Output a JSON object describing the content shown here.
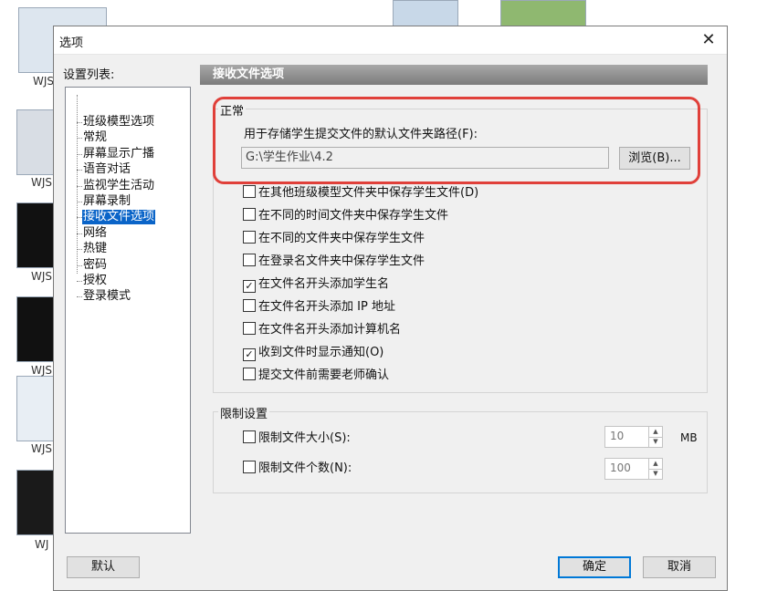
{
  "background": {
    "icon_labels": [
      "WJS",
      "WJS",
      "WJS",
      "WJS",
      "WJS",
      "WJ"
    ]
  },
  "dialog": {
    "title": "选项",
    "close_glyph": "✕",
    "settings_list_label": "设置列表:",
    "tree_items": [
      {
        "label": "班级模型选项",
        "selected": false
      },
      {
        "label": "常规",
        "selected": false
      },
      {
        "label": "屏幕显示广播",
        "selected": false
      },
      {
        "label": "语音对话",
        "selected": false
      },
      {
        "label": "监视学生活动",
        "selected": false
      },
      {
        "label": "屏幕录制",
        "selected": false
      },
      {
        "label": "接收文件选项",
        "selected": true
      },
      {
        "label": "网络",
        "selected": false
      },
      {
        "label": "热键",
        "selected": false
      },
      {
        "label": "密码",
        "selected": false
      },
      {
        "label": "授权",
        "selected": false
      },
      {
        "label": "登录模式",
        "selected": false
      }
    ],
    "panel_title": "接收文件选项",
    "normal_group": {
      "label": "正常",
      "path_label": "用于存储学生提交文件的默认文件夹路径(F):",
      "path_value": "G:\\学生作业\\4.2",
      "browse_label": "浏览(B)...",
      "options": [
        {
          "label": "在其他班级模型文件夹中保存学生文件(D)",
          "checked": false
        },
        {
          "label": "在不同的时间文件夹中保存学生文件",
          "checked": false
        },
        {
          "label": "在不同的文件夹中保存学生文件",
          "checked": false
        },
        {
          "label": "在登录名文件夹中保存学生文件",
          "checked": false
        },
        {
          "label": "在文件名开头添加学生名",
          "checked": true
        },
        {
          "label": "在文件名开头添加 IP 地址",
          "checked": false
        },
        {
          "label": "在文件名开头添加计算机名",
          "checked": false
        },
        {
          "label": "收到文件时显示通知(O)",
          "checked": true
        },
        {
          "label": "提交文件前需要老师确认",
          "checked": false
        }
      ]
    },
    "limit_group": {
      "label": "限制设置",
      "size_label": "限制文件大小(S):",
      "size_checked": false,
      "size_value": "10",
      "size_unit": "MB",
      "count_label": "限制文件个数(N):",
      "count_checked": false,
      "count_value": "100"
    },
    "buttons": {
      "default_label": "默认",
      "ok_label": "确定",
      "cancel_label": "取消"
    }
  },
  "colors": {
    "highlight_outline": "#e0403a",
    "selection": "#0a64c8",
    "focus_border": "#0078d7"
  }
}
